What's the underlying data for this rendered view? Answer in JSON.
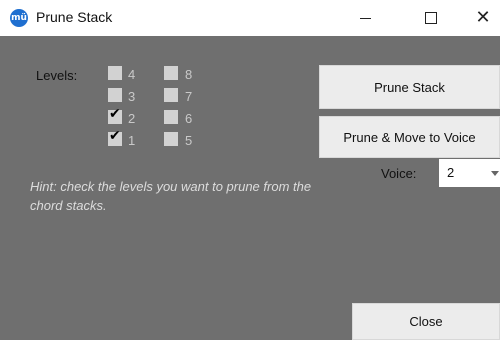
{
  "window": {
    "title": "Prune Stack",
    "app_icon_text": "mü"
  },
  "titlebar_controls": {
    "minimize": "—",
    "maximize": "□",
    "close": "✕"
  },
  "levels": {
    "label": "Levels:",
    "checkboxes": [
      {
        "level": "4",
        "checked": false
      },
      {
        "level": "3",
        "checked": false
      },
      {
        "level": "2",
        "checked": true
      },
      {
        "level": "1",
        "checked": true
      },
      {
        "level": "8",
        "checked": false
      },
      {
        "level": "7",
        "checked": false
      },
      {
        "level": "6",
        "checked": false
      },
      {
        "level": "5",
        "checked": false
      }
    ]
  },
  "hint": "Hint: check the levels you want to prune from the chord stacks.",
  "buttons": {
    "prune_stack": "Prune Stack",
    "prune_move": "Prune & Move to Voice",
    "close": "Close"
  },
  "voice": {
    "label": "Voice:",
    "selected": "2"
  }
}
